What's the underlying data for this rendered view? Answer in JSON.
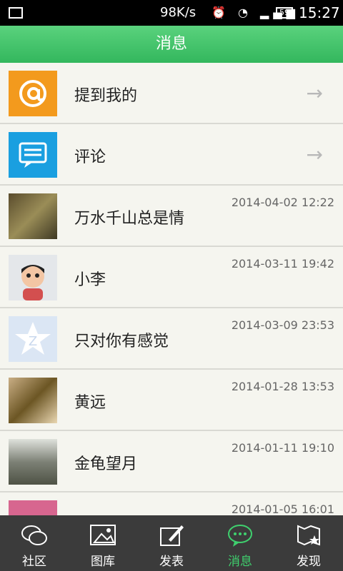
{
  "status_bar": {
    "network_speed": "98K/s",
    "time": "15:27",
    "battery": "59"
  },
  "header": {
    "title": "消息"
  },
  "list": {
    "items": [
      {
        "label": "提到我的"
      },
      {
        "label": "评论"
      },
      {
        "label": "万水千山总是情",
        "date": "2014-04-02 12:22"
      },
      {
        "label": "小李",
        "date": "2014-03-11 19:42"
      },
      {
        "label": "只对你有感觉",
        "date": "2014-03-09 23:53"
      },
      {
        "label": "黄远",
        "date": "2014-01-28 13:53"
      },
      {
        "label": "金龟望月",
        "date": "2014-01-11 19:10"
      },
      {
        "label": "",
        "date": "2014-01-05 16:01"
      }
    ]
  },
  "bottom_nav": {
    "items": [
      {
        "label": "社区"
      },
      {
        "label": "图库"
      },
      {
        "label": "发表"
      },
      {
        "label": "消息"
      },
      {
        "label": "发现"
      }
    ]
  }
}
